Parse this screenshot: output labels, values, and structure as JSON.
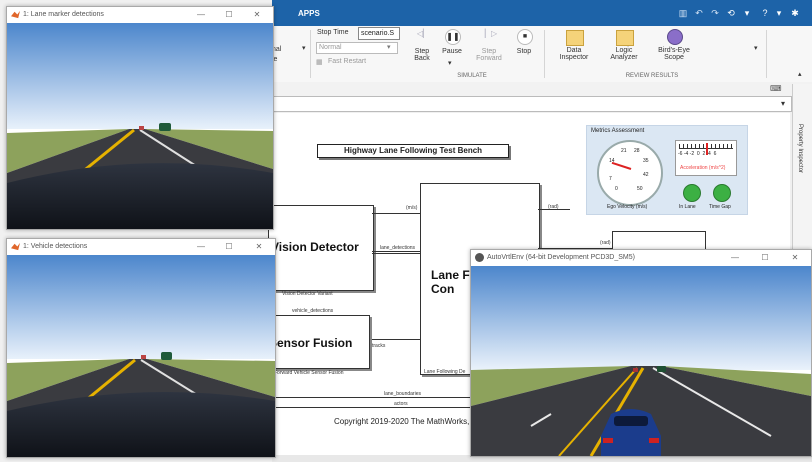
{
  "windows": {
    "lane": {
      "title": "1: Lane marker detections"
    },
    "vehicle": {
      "title": "1: Vehicle detections"
    },
    "autovrt": {
      "title": "AutoVrtlEnv (64-bit Development PCD3D_SM5)"
    }
  },
  "simulink": {
    "tab": "APPS",
    "stop_time_label": "Stop Time",
    "stop_time_value": "scenario.S",
    "mode_value": "Normal",
    "fast_restart": "Fast Restart",
    "left_fragment_top": "nal",
    "left_fragment_bottom": "le",
    "buttons": {
      "step_back": "Step\nBack",
      "pause": "Pause",
      "step_forward": "Step\nForward",
      "stop": "Stop",
      "data_inspector": "Data\nInspector",
      "logic_analyzer": "Logic\nAnalyzer",
      "birds_eye": "Bird's-Eye\nScope"
    },
    "sections": {
      "simulate": "SIMULATE",
      "review": "REVIEW RESULTS"
    },
    "property_inspector": "Property Inspector"
  },
  "model": {
    "title": "Highway Lane Following Test Bench",
    "metrics_title": "Metrics Assessment",
    "gauge_ticks": [
      "7",
      "14",
      "21",
      "28",
      "35",
      "42",
      "0",
      "50"
    ],
    "gauge_label": "Ego Velocity (m/s)",
    "accel_label": "Acceleration (m/s^2)",
    "accel_ticks": "-6 -4 -2  0  2  4  6",
    "lamp_in_lane": "In Lane",
    "lamp_time_gap": "Time Gap",
    "vision_detector": "Vision Detector",
    "vision_detector_variant": "Vision Detector Variant",
    "sensor_fusion": "Sensor Fusion",
    "forward_vehicle_sensor_fusion": "Forward Vehicle Sensor Fusion",
    "lane_following_title": "Lane F\nCon",
    "lane_following_variant": "Lane Following De",
    "signals": {
      "mps": "(m/s)",
      "rad": "(rad)",
      "rad2": "(rad)",
      "lane_detections": "lane_detections",
      "vehicle_detections": "vehicle_detections",
      "tracks": "tracks",
      "lane_boundaries": "lane_boundaries",
      "actors": "actors"
    },
    "copyright": "Copyright 2019-2020 The MathWorks, I"
  },
  "colors": {
    "titlebar": "#1d63a8",
    "lamp": "#3cb043",
    "sky_top": "#4c86cc",
    "grass": "#8da25c",
    "road": "#3a3b40"
  }
}
